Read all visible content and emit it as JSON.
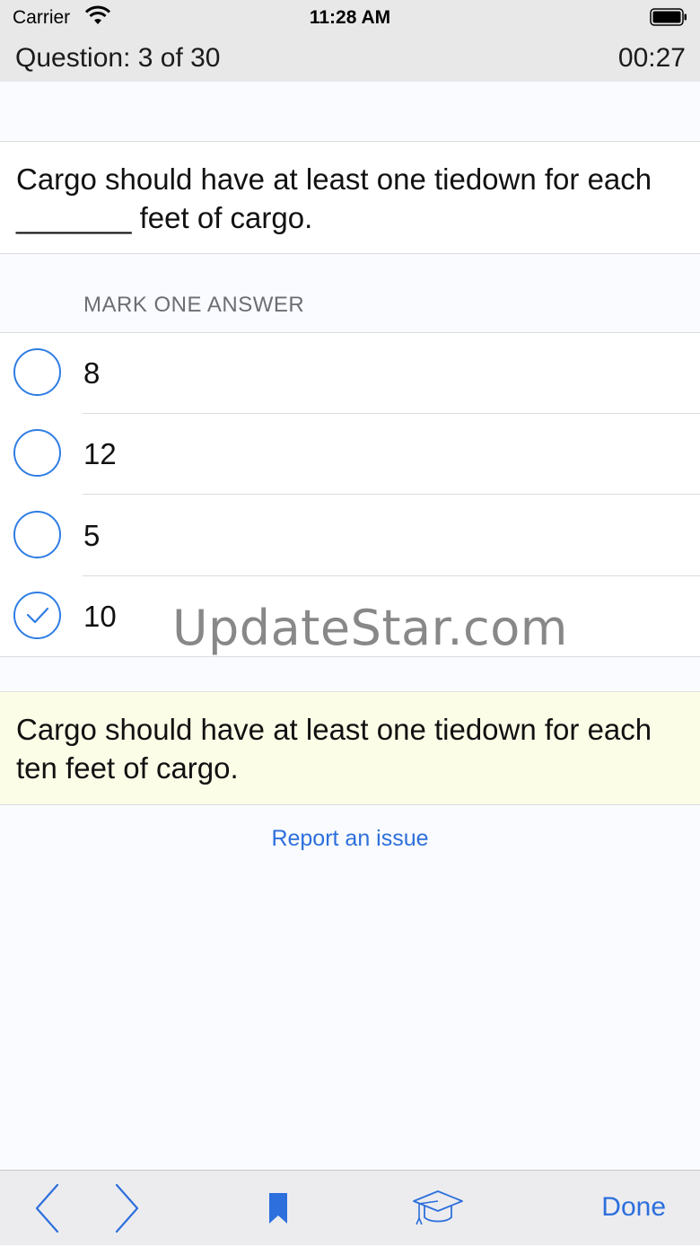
{
  "status_bar": {
    "carrier": "Carrier",
    "time": "11:28 AM"
  },
  "header": {
    "counter": "Question: 3 of 30",
    "timer": "00:27"
  },
  "question": {
    "text": "Cargo should have at least one tiedown for each _______ feet of cargo."
  },
  "answers_section": {
    "header": "MARK ONE ANSWER",
    "options": [
      {
        "label": "8",
        "selected": false
      },
      {
        "label": "12",
        "selected": false
      },
      {
        "label": "5",
        "selected": false
      },
      {
        "label": "10",
        "selected": true
      }
    ]
  },
  "watermark": "UpdateStar.com",
  "explanation": {
    "text": "Cargo should have at least one tiedown for each ten feet of cargo."
  },
  "report_link": "Report an issue",
  "toolbar": {
    "icons": [
      "chevron-left-icon",
      "chevron-right-icon",
      "bookmark-icon",
      "graduation-cap-icon"
    ],
    "done_label": "Done"
  },
  "colors": {
    "accent": "#2d6fdc",
    "radio": "#2f7de4",
    "explanation_bg": "#fcfde7",
    "header_bg": "#e8e8e9"
  }
}
